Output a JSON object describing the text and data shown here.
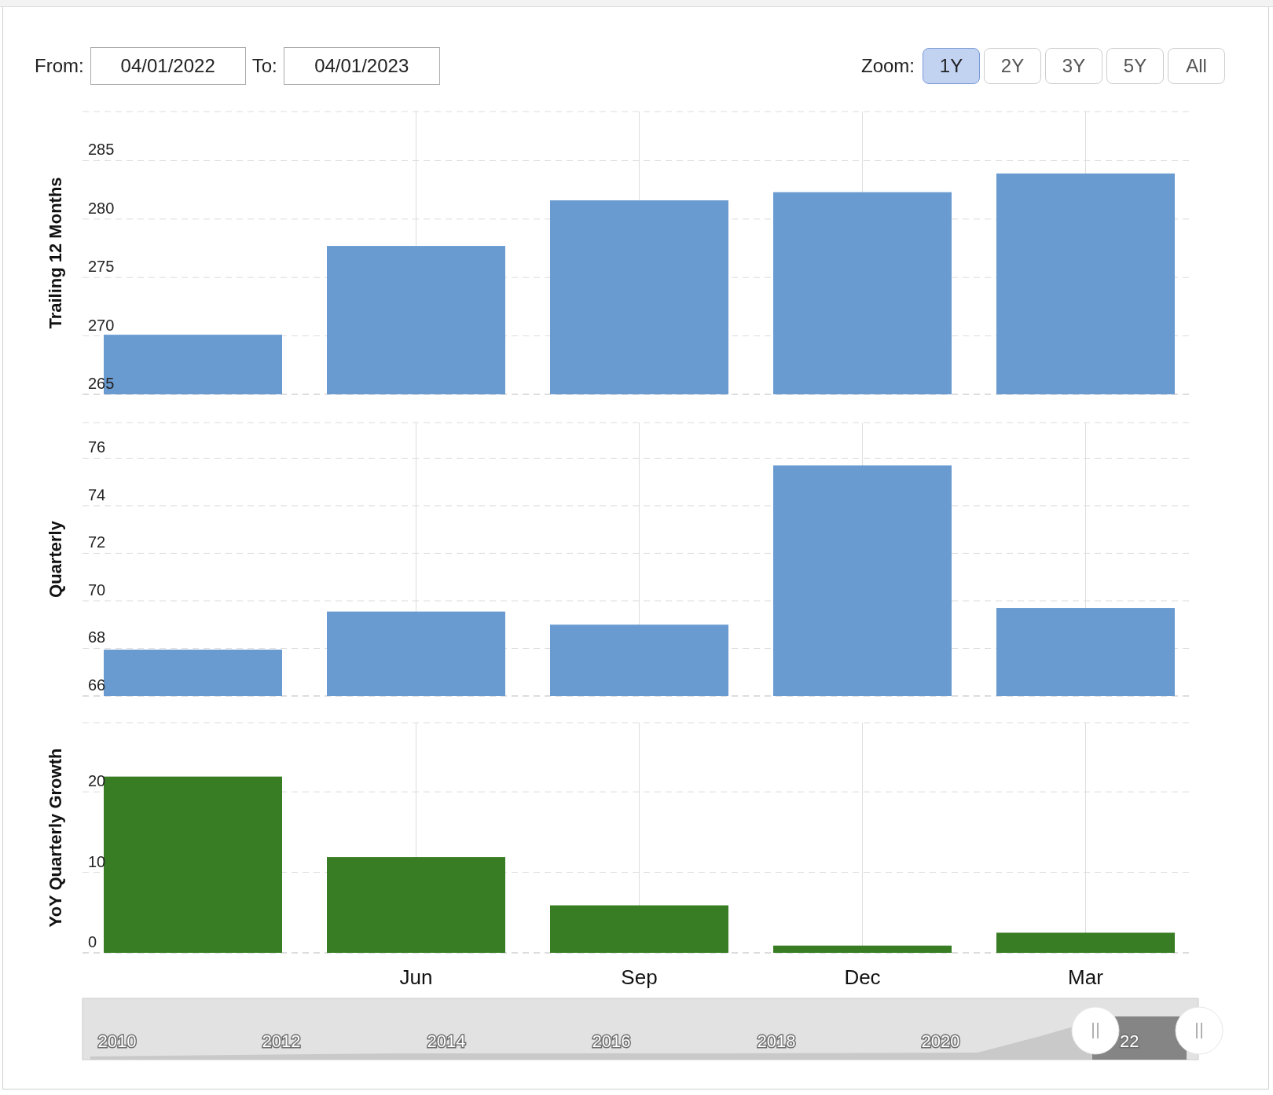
{
  "date_range": {
    "from_label": "From:",
    "from_value": "04/01/2022",
    "to_label": "To:",
    "to_value": "04/01/2023"
  },
  "zoom": {
    "label": "Zoom:",
    "buttons": [
      {
        "label": "1Y",
        "selected": true
      },
      {
        "label": "2Y",
        "selected": false
      },
      {
        "label": "3Y",
        "selected": false
      },
      {
        "label": "5Y",
        "selected": false
      },
      {
        "label": "All",
        "selected": false
      }
    ]
  },
  "charts": [
    {
      "chart_data": {
        "type": "bar",
        "ylabel": "Trailing 12 Months",
        "grid": true,
        "ylim": [
          265,
          289.2
        ],
        "yticks": [
          265,
          270,
          275,
          280,
          285
        ],
        "series": [
          {
            "color": "#6a9bd0",
            "values": [
              270.1,
              277.7,
              281.6,
              282.3,
              283.9
            ]
          }
        ]
      }
    },
    {
      "chart_data": {
        "type": "bar",
        "ylabel": "Quarterly",
        "grid": true,
        "ylim": [
          66,
          77.5
        ],
        "yticks": [
          66,
          68,
          70,
          72,
          74,
          76
        ],
        "series": [
          {
            "color": "#6a9bd0",
            "values": [
              67.95,
              69.55,
              69.0,
              75.7,
              69.7
            ]
          }
        ]
      }
    },
    {
      "chart_data": {
        "type": "bar",
        "ylabel": "YoY Quarterly Growth",
        "grid": true,
        "ylim": [
          0,
          28.6
        ],
        "yticks": [
          0,
          10,
          20
        ],
        "categories": [
          null,
          "Jun",
          "Sep",
          "Dec",
          "Mar"
        ],
        "series": [
          {
            "color": "#387d24",
            "values": [
              21.9,
              11.9,
              5.9,
              0.9,
              2.5
            ]
          }
        ]
      }
    }
  ],
  "navigator": {
    "labels": [
      "2010",
      "2012",
      "2014",
      "2016",
      "2018",
      "2020",
      "22"
    ]
  }
}
